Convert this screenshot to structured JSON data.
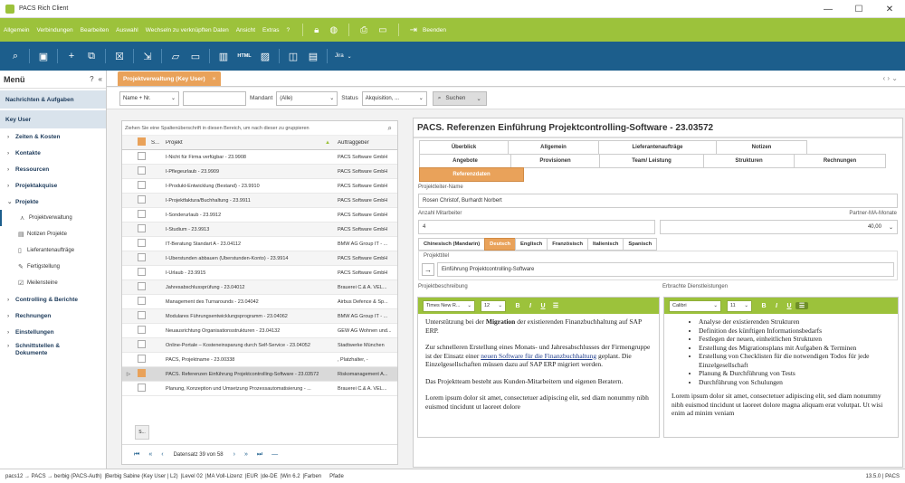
{
  "window": {
    "title": "PACS Rich Client"
  },
  "menu": {
    "items": [
      "Allgemein",
      "Verbindungen",
      "Bearbeiten",
      "Auswahl",
      "Wechseln zu verknüpften Daten",
      "Ansicht",
      "Extras"
    ],
    "help": "?",
    "end": "Beenden"
  },
  "toolbar": {
    "html_label": "HTML",
    "jira_label": "Jira"
  },
  "sidebar": {
    "title": "Menü",
    "nachrichten": "Nachrichten & Aufgaben",
    "keyuser": "Key User",
    "groups1": [
      "Zeiten & Kosten",
      "Kontakte",
      "Ressourcen",
      "Projektakquise"
    ],
    "projekte": "Projekte",
    "subitems": [
      "Projektverwaltung",
      "Notizen Projekte",
      "Lieferantenaufträge",
      "Fertigstellung",
      "Meilensteine"
    ],
    "groups2": [
      "Controlling & Berichte",
      "Rechnungen",
      "Einstellungen",
      "Schnittstellen & Dokumente"
    ]
  },
  "tab": {
    "label": "Projektverwaltung (Key User)",
    "close": "×"
  },
  "filters": {
    "field1": "Name + Nr.",
    "mandant_label": "Mandant",
    "mandant_value": "(Alle)",
    "status_label": "Status",
    "status_value": "Akquisition, ...",
    "search": "Suchen"
  },
  "grid": {
    "group_hint": "Ziehen Sie eine Spaltenüberschrift in diesen Bereich, um nach dieser zu gruppieren",
    "col_s": "S...",
    "col_projekt": "Projekt",
    "col_auftraggeber": "Auftraggeber",
    "rows": [
      {
        "projekt": "I-Nicht für Firma verfügbar - 23.9908",
        "auftraggeber": "PACS Software GmbH"
      },
      {
        "projekt": "I-Pflegeurlaub - 23.9909",
        "auftraggeber": "PACS Software GmbH"
      },
      {
        "projekt": "I-Produkt-Entwicklung (Bestand) - 23.9910",
        "auftraggeber": "PACS Software GmbH"
      },
      {
        "projekt": "I-Projektfaktura/Buchhaltung - 23.9911",
        "auftraggeber": "PACS Software GmbH"
      },
      {
        "projekt": "I-Sonderurlaub - 23.9912",
        "auftraggeber": "PACS Software GmbH"
      },
      {
        "projekt": "I-Studium - 23.9913",
        "auftraggeber": "PACS Software GmbH"
      },
      {
        "projekt": "IT-Beratung Standart A - 23.04112",
        "auftraggeber": "BMW AG Group IT - ..."
      },
      {
        "projekt": "I-Überstunden abbauen (Überstunden-Konto) - 23.9914",
        "auftraggeber": "PACS Software GmbH"
      },
      {
        "projekt": "I-Urlaub - 23.9915",
        "auftraggeber": "PACS Software GmbH"
      },
      {
        "projekt": "Jahresabschlussprüfung - 23.04012",
        "auftraggeber": "Brauerei C.& A. VEL..."
      },
      {
        "projekt": "Management des Turnarounds - 23.04042",
        "auftraggeber": "Airbus Defence & Sp..."
      },
      {
        "projekt": "Modulares Führungsentwicklungsprogramm - 23.04062",
        "auftraggeber": "BMW AG Group IT - ..."
      },
      {
        "projekt": "Neuausrichtung Organisationsstrukturen - 23.04132",
        "auftraggeber": "GEW AG Wohnen und..."
      },
      {
        "projekt": "Online-Portale – Kosteneinsparung durch Self-Service - 23.04052",
        "auftraggeber": "Stadtwerke München"
      },
      {
        "projekt": "PACS, Projektname - 23.00338",
        "auftraggeber": ", Platzhalter, -"
      },
      {
        "projekt": "PACS. Referenzen Einführung Projektcontrolling-Software - 23.03572",
        "auftraggeber": "Riskomanagement A..."
      },
      {
        "projekt": "Planung, Konzeption und Umsetzung Prozessautomatisierung - ...",
        "auftraggeber": "Brauerei C.& A. VEL..."
      }
    ],
    "footer_s": "S...",
    "pager_text": "Datensatz 39 von 58"
  },
  "detail": {
    "title": "PACS. Referenzen Einführung Projektcontrolling-Software - 23.03572",
    "tabs_row1": [
      "Überblick",
      "Allgemein",
      "Lieferantenaufträge",
      "Notizen",
      "Angebote"
    ],
    "tabs_row2": [
      "Provisionen",
      "Team/ Leistung",
      "Strukturen",
      "Rechnungen",
      "Referenzdaten"
    ],
    "projektleiter_label": "Projektleiter-Name",
    "projektleiter_value": "Rosen Christof, Burhardt Norbert",
    "anzahl_label": "Anzahl Mitarbeiter",
    "anzahl_value": "4",
    "partner_label": "Partner-MA-Monate",
    "partner_value": "40,00",
    "lang_tabs": [
      "Chinesisch (Mandarin)",
      "Deutsch",
      "Englisch",
      "Französisch",
      "Italienisch",
      "Spanisch"
    ],
    "projekttitel_label": "Projekttitel",
    "projekttitel_value": "Einführung Projektcontrolling-Software",
    "beschreibung_label": "Projektbeschreibung",
    "leistungen_label": "Erbrachte Dienstleistungen",
    "editor1_font": "Times New R...",
    "editor1_size": "12",
    "editor2_font": "Calibri",
    "editor2_size": "11",
    "bold": "B",
    "italic": "I",
    "underline": "U",
    "desc_p1_a": "Unterstützung bei der ",
    "desc_p1_b": "Migration",
    "desc_p1_c": " der existierenden Finanzbuchhaltung auf SAP ERP.",
    "desc_p2_a": "Zur schnelleren Erstellung eines Monats- und Jahresabschlusses der Firmengruppe ist der Einsatz einer ",
    "desc_p2_b": "neuen Software für die Finanzbuchhaltung",
    "desc_p2_c": " geplant. Die Einzelgesellschaften müssen dazu auf SAP ERP migriert werden.",
    "desc_p3": "Das Projektteam besteht aus Kunden-Mitarbeitern und eigenen Beratern.",
    "desc_p4": "Lorem ipsum dolor sit amet, consectetuer adipiscing elit, sed diam nonummy nibh euismod tincidunt ut laoreet dolore",
    "services": [
      "Analyse der existierenden Strukturen",
      "Definition des künftigen Informationsbedarfs",
      "Festlegen der neuen, einheitlichen Strukturen",
      "Erstellung des Migrationsplans mit Aufgaben & Terminen",
      "Erstellung von Checklisten für die notwendigen Todos für jede Einzelgesellschaft",
      "Planung & Durchführung von Tests",
      "Durchführung von Schulungen"
    ],
    "services_p": "Lorem ipsum dolor sit amet, consectetuer adipiscing elit, sed diam nonummy nibh euismod tincidunt ut laoreet dolore magna aliquam erat volutpat. Ut wisi enim ad minim veniam"
  },
  "status": {
    "items": [
      "pacs12 → PACS → berbig (PACS-Auth)",
      "|Berbig Sabine (Key User | L2)",
      "|Level 02",
      "|MA Voll-Lizenz",
      "|EUR",
      "|de-DE",
      "|Win 6.2",
      "|Farben",
      "Pfade"
    ],
    "version": "13.5.0 | PACS"
  },
  "colors": {
    "accent_green": "#9cc23b",
    "toolbar_blue": "#1c5e8c",
    "active_orange": "#e9a25a"
  }
}
